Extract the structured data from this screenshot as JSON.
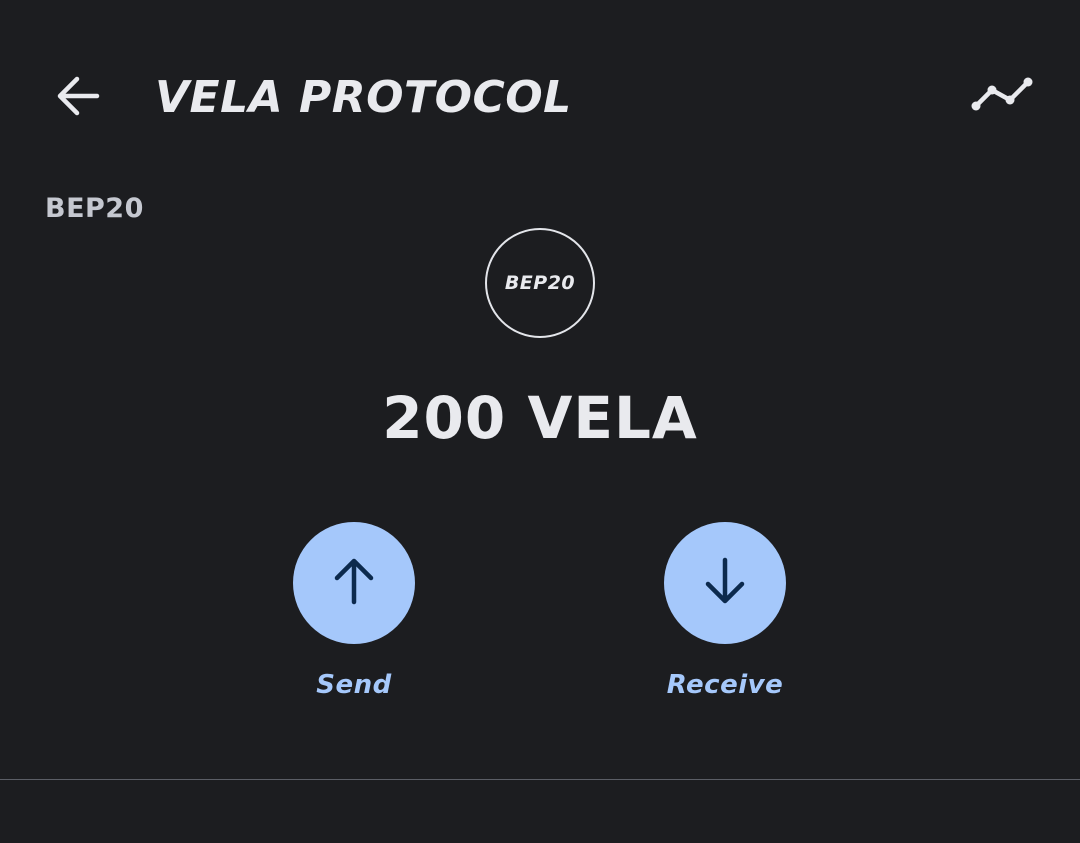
{
  "header": {
    "title": "VELA PROTOCOL",
    "back_icon": "arrow-left-icon",
    "chart_icon": "line-chart-icon"
  },
  "token": {
    "network": "BEP20",
    "badge_text": "BEP20",
    "balance": "200 VELA"
  },
  "actions": {
    "send_label": "Send",
    "send_icon": "arrow-up-icon",
    "receive_label": "Receive",
    "receive_icon": "arrow-down-icon"
  },
  "colors": {
    "background": "#1c1d20",
    "text": "#e9eaee",
    "accent": "#a5c8fb",
    "accent_icon": "#0c2a4d"
  }
}
